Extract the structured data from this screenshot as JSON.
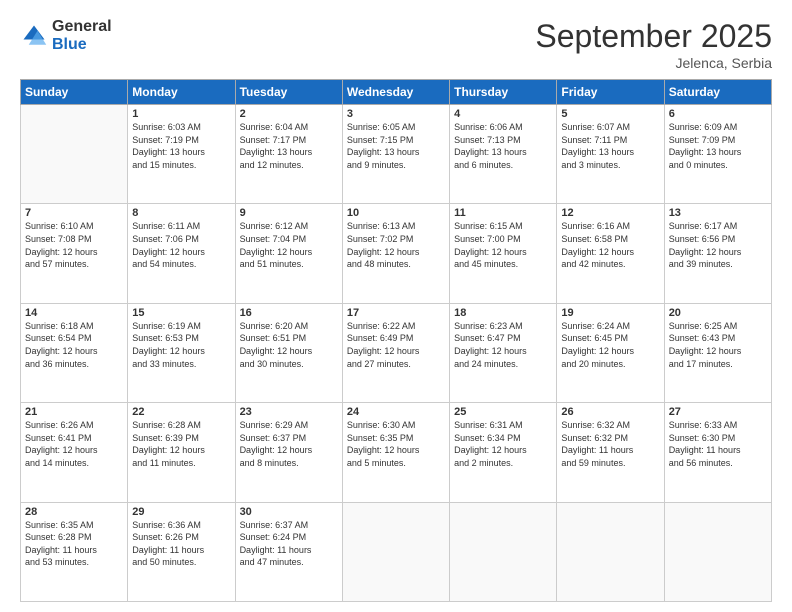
{
  "logo": {
    "general": "General",
    "blue": "Blue"
  },
  "header": {
    "month": "September 2025",
    "location": "Jelenca, Serbia"
  },
  "weekdays": [
    "Sunday",
    "Monday",
    "Tuesday",
    "Wednesday",
    "Thursday",
    "Friday",
    "Saturday"
  ],
  "weeks": [
    [
      {
        "day": "",
        "info": ""
      },
      {
        "day": "1",
        "info": "Sunrise: 6:03 AM\nSunset: 7:19 PM\nDaylight: 13 hours\nand 15 minutes."
      },
      {
        "day": "2",
        "info": "Sunrise: 6:04 AM\nSunset: 7:17 PM\nDaylight: 13 hours\nand 12 minutes."
      },
      {
        "day": "3",
        "info": "Sunrise: 6:05 AM\nSunset: 7:15 PM\nDaylight: 13 hours\nand 9 minutes."
      },
      {
        "day": "4",
        "info": "Sunrise: 6:06 AM\nSunset: 7:13 PM\nDaylight: 13 hours\nand 6 minutes."
      },
      {
        "day": "5",
        "info": "Sunrise: 6:07 AM\nSunset: 7:11 PM\nDaylight: 13 hours\nand 3 minutes."
      },
      {
        "day": "6",
        "info": "Sunrise: 6:09 AM\nSunset: 7:09 PM\nDaylight: 13 hours\nand 0 minutes."
      }
    ],
    [
      {
        "day": "7",
        "info": "Sunrise: 6:10 AM\nSunset: 7:08 PM\nDaylight: 12 hours\nand 57 minutes."
      },
      {
        "day": "8",
        "info": "Sunrise: 6:11 AM\nSunset: 7:06 PM\nDaylight: 12 hours\nand 54 minutes."
      },
      {
        "day": "9",
        "info": "Sunrise: 6:12 AM\nSunset: 7:04 PM\nDaylight: 12 hours\nand 51 minutes."
      },
      {
        "day": "10",
        "info": "Sunrise: 6:13 AM\nSunset: 7:02 PM\nDaylight: 12 hours\nand 48 minutes."
      },
      {
        "day": "11",
        "info": "Sunrise: 6:15 AM\nSunset: 7:00 PM\nDaylight: 12 hours\nand 45 minutes."
      },
      {
        "day": "12",
        "info": "Sunrise: 6:16 AM\nSunset: 6:58 PM\nDaylight: 12 hours\nand 42 minutes."
      },
      {
        "day": "13",
        "info": "Sunrise: 6:17 AM\nSunset: 6:56 PM\nDaylight: 12 hours\nand 39 minutes."
      }
    ],
    [
      {
        "day": "14",
        "info": "Sunrise: 6:18 AM\nSunset: 6:54 PM\nDaylight: 12 hours\nand 36 minutes."
      },
      {
        "day": "15",
        "info": "Sunrise: 6:19 AM\nSunset: 6:53 PM\nDaylight: 12 hours\nand 33 minutes."
      },
      {
        "day": "16",
        "info": "Sunrise: 6:20 AM\nSunset: 6:51 PM\nDaylight: 12 hours\nand 30 minutes."
      },
      {
        "day": "17",
        "info": "Sunrise: 6:22 AM\nSunset: 6:49 PM\nDaylight: 12 hours\nand 27 minutes."
      },
      {
        "day": "18",
        "info": "Sunrise: 6:23 AM\nSunset: 6:47 PM\nDaylight: 12 hours\nand 24 minutes."
      },
      {
        "day": "19",
        "info": "Sunrise: 6:24 AM\nSunset: 6:45 PM\nDaylight: 12 hours\nand 20 minutes."
      },
      {
        "day": "20",
        "info": "Sunrise: 6:25 AM\nSunset: 6:43 PM\nDaylight: 12 hours\nand 17 minutes."
      }
    ],
    [
      {
        "day": "21",
        "info": "Sunrise: 6:26 AM\nSunset: 6:41 PM\nDaylight: 12 hours\nand 14 minutes."
      },
      {
        "day": "22",
        "info": "Sunrise: 6:28 AM\nSunset: 6:39 PM\nDaylight: 12 hours\nand 11 minutes."
      },
      {
        "day": "23",
        "info": "Sunrise: 6:29 AM\nSunset: 6:37 PM\nDaylight: 12 hours\nand 8 minutes."
      },
      {
        "day": "24",
        "info": "Sunrise: 6:30 AM\nSunset: 6:35 PM\nDaylight: 12 hours\nand 5 minutes."
      },
      {
        "day": "25",
        "info": "Sunrise: 6:31 AM\nSunset: 6:34 PM\nDaylight: 12 hours\nand 2 minutes."
      },
      {
        "day": "26",
        "info": "Sunrise: 6:32 AM\nSunset: 6:32 PM\nDaylight: 11 hours\nand 59 minutes."
      },
      {
        "day": "27",
        "info": "Sunrise: 6:33 AM\nSunset: 6:30 PM\nDaylight: 11 hours\nand 56 minutes."
      }
    ],
    [
      {
        "day": "28",
        "info": "Sunrise: 6:35 AM\nSunset: 6:28 PM\nDaylight: 11 hours\nand 53 minutes."
      },
      {
        "day": "29",
        "info": "Sunrise: 6:36 AM\nSunset: 6:26 PM\nDaylight: 11 hours\nand 50 minutes."
      },
      {
        "day": "30",
        "info": "Sunrise: 6:37 AM\nSunset: 6:24 PM\nDaylight: 11 hours\nand 47 minutes."
      },
      {
        "day": "",
        "info": ""
      },
      {
        "day": "",
        "info": ""
      },
      {
        "day": "",
        "info": ""
      },
      {
        "day": "",
        "info": ""
      }
    ]
  ]
}
